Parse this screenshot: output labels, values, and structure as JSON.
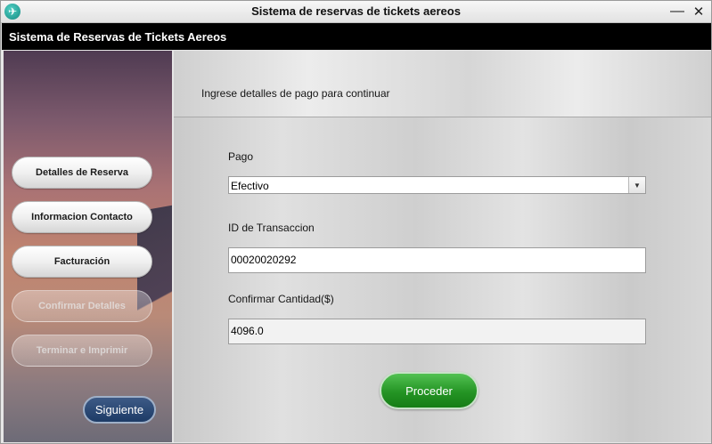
{
  "window": {
    "title": "Sistema de reservas de tickets aereos",
    "icon": "airplane-icon",
    "minimize_glyph": "—",
    "close_glyph": "✕"
  },
  "header": {
    "title": "Sistema de Reservas de Tickets Aereos"
  },
  "sidebar": {
    "items": [
      {
        "label": "Detalles de Reserva",
        "enabled": true
      },
      {
        "label": "Informacion Contacto",
        "enabled": true
      },
      {
        "label": "Facturación",
        "enabled": true
      },
      {
        "label": "Confirmar Detalles",
        "enabled": false
      },
      {
        "label": "Terminar e Imprimir",
        "enabled": false
      }
    ],
    "next_label": "Siguiente"
  },
  "main": {
    "subtitle": "Ingrese detalles de pago para continuar",
    "payment": {
      "label": "Pago",
      "selected": "Efectivo"
    },
    "transaction": {
      "label": "ID de Transaccion",
      "value": "00020020292"
    },
    "amount": {
      "label": "Confirmar Cantidad($)",
      "value": "4096.0"
    },
    "proceed_label": "Proceder"
  },
  "colors": {
    "header_bg": "#000000",
    "proceed_green": "#249424",
    "next_blue": "#1d3b66"
  }
}
